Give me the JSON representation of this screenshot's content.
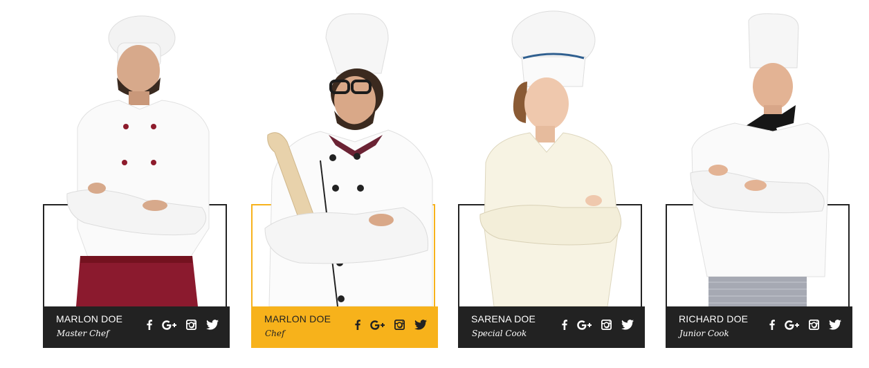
{
  "team": {
    "members": [
      {
        "name": "MARLON DOE",
        "role": "Master Chef",
        "highlighted": false
      },
      {
        "name": "MARLON DOE",
        "role": "Chef",
        "highlighted": true
      },
      {
        "name": "SARENA DOE",
        "role": "Special Cook",
        "highlighted": false
      },
      {
        "name": "RICHARD DOE",
        "role": "Junior Cook",
        "highlighted": false
      }
    ],
    "social_icons": [
      "facebook-icon",
      "google-plus-icon",
      "instagram-icon",
      "twitter-icon"
    ]
  },
  "colors": {
    "accent": "#f7b21b",
    "bar_dark": "#222222",
    "text_light": "#ffffff",
    "text_dark": "#222222"
  }
}
